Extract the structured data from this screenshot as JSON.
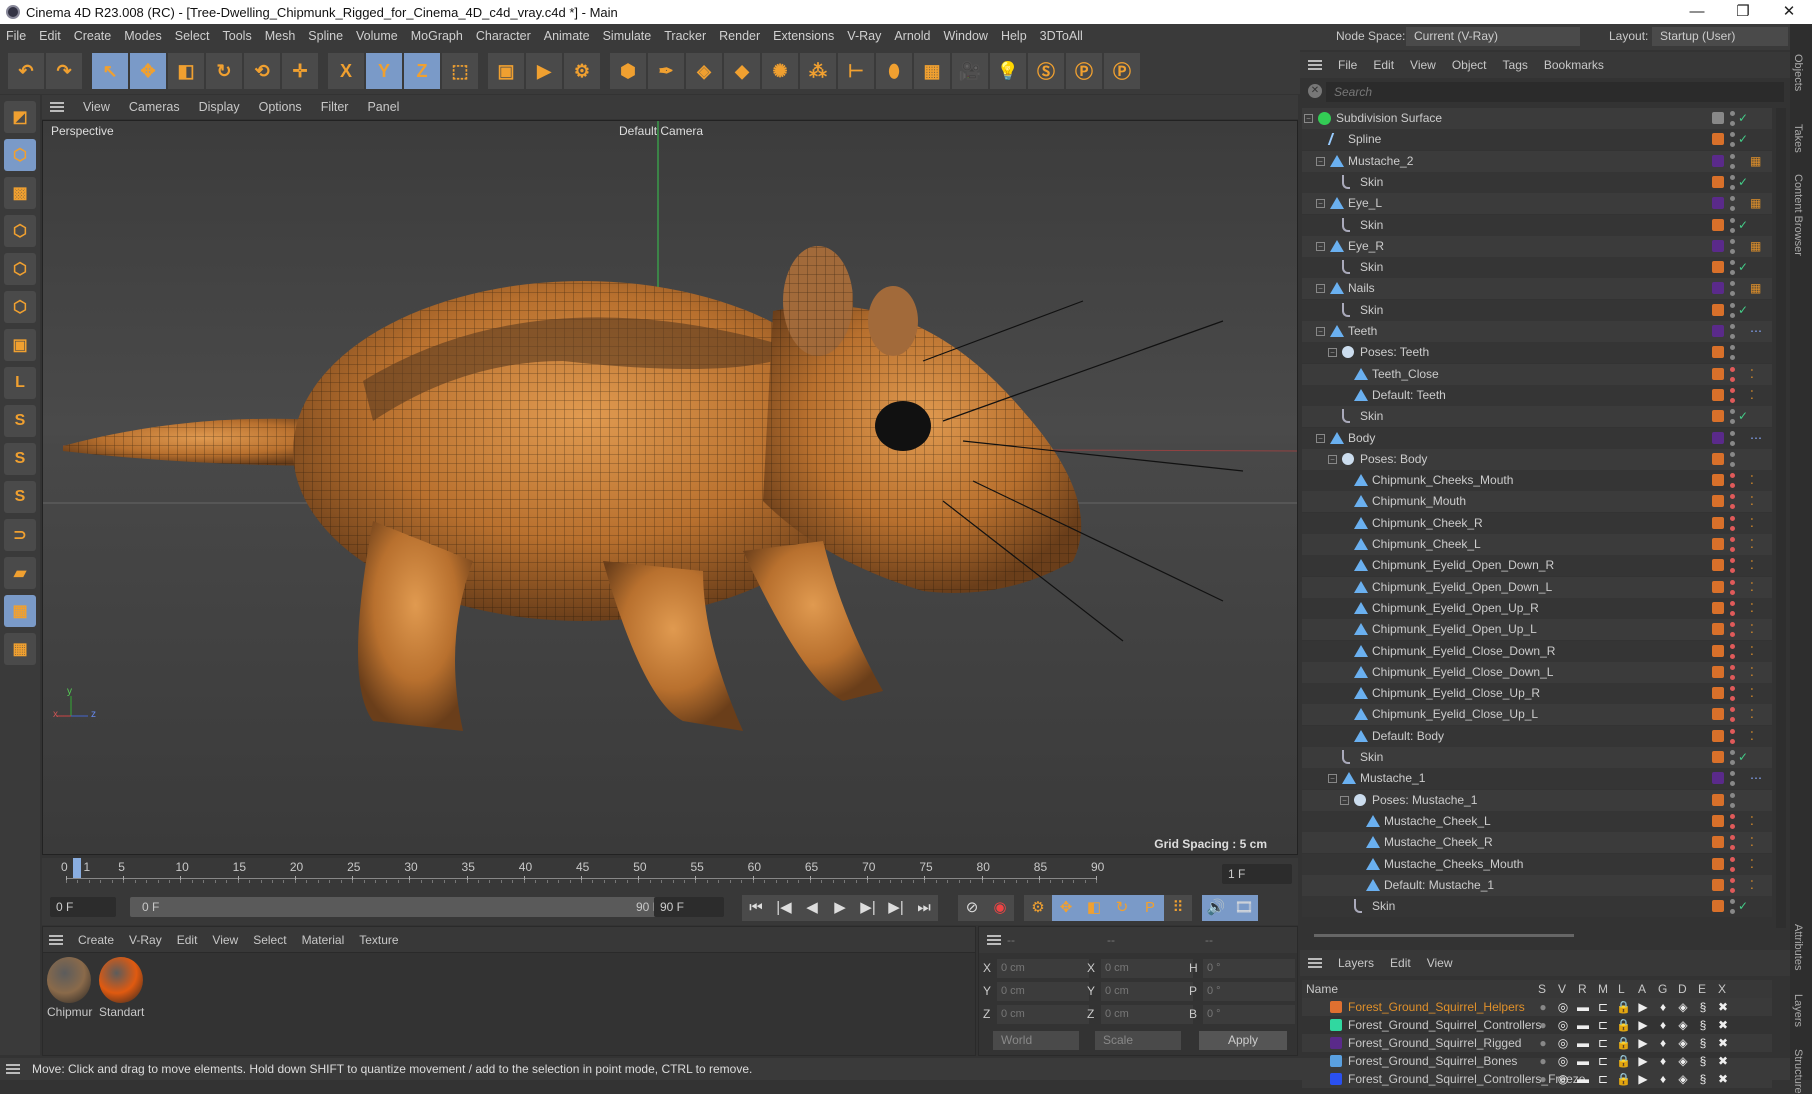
{
  "window": {
    "title": "Cinema 4D R23.008 (RC) - [Tree-Dwelling_Chipmunk_Rigged_for_Cinema_4D_c4d_vray.c4d *] - Main",
    "minimize": "—",
    "maximize": "❐",
    "close": "✕"
  },
  "menu": [
    "File",
    "Edit",
    "Create",
    "Modes",
    "Select",
    "Tools",
    "Mesh",
    "Spline",
    "Volume",
    "MoGraph",
    "Character",
    "Animate",
    "Simulate",
    "Tracker",
    "Render",
    "Extensions",
    "V-Ray",
    "Arnold",
    "Window",
    "Help",
    "3DToAll"
  ],
  "toolbar": [
    {
      "name": "undo",
      "g": "↶"
    },
    {
      "name": "redo",
      "g": "↷"
    },
    {
      "name": "select-tool",
      "g": "↖",
      "sel": true,
      "gap": true
    },
    {
      "name": "move-tool",
      "g": "✥",
      "sel": true
    },
    {
      "name": "scale-tool",
      "g": "◧"
    },
    {
      "name": "rotate-tool",
      "g": "↻"
    },
    {
      "name": "psr",
      "g": "⟲"
    },
    {
      "name": "transform",
      "g": "✛"
    },
    {
      "name": "x-axis",
      "g": "X",
      "gap": true
    },
    {
      "name": "y-axis",
      "g": "Y",
      "sel": true
    },
    {
      "name": "z-axis",
      "g": "Z",
      "sel": true
    },
    {
      "name": "coord-system",
      "g": "⬚"
    },
    {
      "name": "render-view",
      "g": "▣",
      "gap": true
    },
    {
      "name": "render-picture",
      "g": "▶"
    },
    {
      "name": "render-settings",
      "g": "⚙"
    },
    {
      "name": "cube",
      "g": "⬢",
      "gap": true
    },
    {
      "name": "pen",
      "g": "✒"
    },
    {
      "name": "subdivision",
      "g": "◈"
    },
    {
      "name": "extrude",
      "g": "◆"
    },
    {
      "name": "mograph-cloner",
      "g": "✺"
    },
    {
      "name": "cloner",
      "g": "⁂"
    },
    {
      "name": "deformer",
      "g": "⊢"
    },
    {
      "name": "field",
      "g": "⬮"
    },
    {
      "name": "floor",
      "g": "▦"
    },
    {
      "name": "camera",
      "g": "🎥"
    },
    {
      "name": "light",
      "g": "💡"
    },
    {
      "name": "vray",
      "g": "Ⓢ"
    },
    {
      "name": "python",
      "g": "Ⓟ"
    },
    {
      "name": "python-2",
      "g": "Ⓟ"
    }
  ],
  "left_tools": [
    {
      "name": "make-editable",
      "g": "◩"
    },
    {
      "name": "model-mode",
      "g": "⬡",
      "sel": true
    },
    {
      "name": "texture-mode",
      "g": "▩"
    },
    {
      "name": "points-mode",
      "g": "⬡"
    },
    {
      "name": "edges-mode",
      "g": "⬡"
    },
    {
      "name": "polygons-mode",
      "g": "⬡"
    },
    {
      "name": "uv-mode",
      "g": "▣"
    },
    {
      "name": "axis-mode",
      "g": "L"
    },
    {
      "name": "snap",
      "g": "S"
    },
    {
      "name": "snap-2",
      "g": "S"
    },
    {
      "name": "snap-3",
      "g": "S"
    },
    {
      "name": "magnet",
      "g": "⊃"
    },
    {
      "name": "workplane",
      "g": "▰"
    },
    {
      "name": "grid-lock",
      "g": "▦",
      "sel": true
    },
    {
      "name": "grid-3",
      "g": "▦"
    }
  ],
  "viewport": {
    "menu": [
      "View",
      "Cameras",
      "Display",
      "Options",
      "Filter",
      "Panel"
    ],
    "label": "Perspective",
    "camera": "Default Camera",
    "grid_spacing": "Grid Spacing : 5 cm",
    "axis": {
      "x": "x",
      "y": "y",
      "z": "z"
    }
  },
  "timeline": {
    "ticks": [
      0,
      5,
      10,
      15,
      20,
      25,
      30,
      35,
      40,
      45,
      50,
      55,
      60,
      65,
      70,
      75,
      80,
      85,
      90
    ],
    "current": "1",
    "current_frame_field": "1 F",
    "start_field": "0 F",
    "range_start": "0 F",
    "range_end": "90 F",
    "end_field": "90 F",
    "max_frame": 90,
    "current_value": 1
  },
  "playback": [
    {
      "name": "goto-start",
      "g": "⏮"
    },
    {
      "name": "prev-key",
      "g": "|◀"
    },
    {
      "name": "prev-frame",
      "g": "◀"
    },
    {
      "name": "play",
      "g": "▶"
    },
    {
      "name": "next-frame",
      "g": "▶|"
    },
    {
      "name": "next-key",
      "g": "▶|"
    },
    {
      "name": "goto-end",
      "g": "⏭"
    },
    {
      "name": "record-keys",
      "g": "⊘"
    },
    {
      "name": "auto-key",
      "g": "◉"
    },
    {
      "name": "keyframe-selection",
      "g": "⚙"
    },
    {
      "name": "key-position",
      "g": "✥"
    },
    {
      "name": "key-scale",
      "g": "◧"
    },
    {
      "name": "key-rotation",
      "g": "↻"
    },
    {
      "name": "key-param",
      "g": "P"
    },
    {
      "name": "key-pla",
      "g": "⠿"
    },
    {
      "name": "sound",
      "g": "🔊"
    },
    {
      "name": "film",
      "g": "🎞"
    }
  ],
  "materials": {
    "menu": [
      "Create",
      "V-Ray",
      "Edit",
      "View",
      "Select",
      "Material",
      "Texture"
    ],
    "items": [
      {
        "label": "Chipmur",
        "color": "#8a6a4a"
      },
      {
        "label": "Standart",
        "color": "#e05a10"
      }
    ]
  },
  "coords": {
    "header": [
      "--",
      "--",
      "--"
    ],
    "rows": [
      {
        "a": "X",
        "av": "0 cm",
        "b": "X",
        "bv": "0 cm",
        "c": "H",
        "cv": "0 °"
      },
      {
        "a": "Y",
        "av": "0 cm",
        "b": "Y",
        "bv": "0 cm",
        "c": "P",
        "cv": "0 °"
      },
      {
        "a": "Z",
        "av": "0 cm",
        "b": "Z",
        "bv": "0 cm",
        "c": "B",
        "cv": "0 °"
      }
    ],
    "world": "World",
    "scale": "Scale",
    "apply": "Apply"
  },
  "status": "Move: Click and drag to move elements. Hold down SHIFT to quantize movement / add to the selection in point mode, CTRL to remove.",
  "right": {
    "node_space_label": "Node Space:",
    "node_space_value": "Current (V-Ray)",
    "layout_label": "Layout:",
    "layout_value": "Startup (User)",
    "menu": [
      "File",
      "Edit",
      "View",
      "Object",
      "Tags",
      "Bookmarks"
    ],
    "search_placeholder": "Search"
  },
  "colors": {
    "orange": "#d8702a",
    "purple": "#5a2a8a",
    "gray": "#888888",
    "red": "#e05a5a",
    "check": "#44cc88"
  },
  "tree": [
    {
      "l": "Subdivision Surface",
      "d": 0,
      "i": "green",
      "e": 1,
      "c": "gray",
      "dt": "gray",
      "k": 1,
      "x": ""
    },
    {
      "l": "Spline",
      "d": 1,
      "i": "spline",
      "c": "orange",
      "dt": "gray",
      "k": 1,
      "x": ""
    },
    {
      "l": "Mustache_2",
      "d": 1,
      "i": "poly",
      "e": 1,
      "c": "purple",
      "dt": "gray",
      "x": "checker"
    },
    {
      "l": "Skin",
      "d": 2,
      "i": "skin",
      "c": "orange",
      "dt": "gray",
      "k": 1,
      "x": ""
    },
    {
      "l": "Eye_L",
      "d": 1,
      "i": "poly",
      "e": 1,
      "c": "purple",
      "dt": "gray",
      "x": "checker"
    },
    {
      "l": "Skin",
      "d": 2,
      "i": "skin",
      "c": "orange",
      "dt": "gray",
      "k": 1,
      "x": ""
    },
    {
      "l": "Eye_R",
      "d": 1,
      "i": "poly",
      "e": 1,
      "c": "purple",
      "dt": "gray",
      "x": "checker"
    },
    {
      "l": "Skin",
      "d": 2,
      "i": "skin",
      "c": "orange",
      "dt": "gray",
      "k": 1,
      "x": ""
    },
    {
      "l": "Nails",
      "d": 1,
      "i": "poly",
      "e": 1,
      "c": "purple",
      "dt": "gray",
      "x": "checker"
    },
    {
      "l": "Skin",
      "d": 2,
      "i": "skin",
      "c": "orange",
      "dt": "gray",
      "k": 1,
      "x": ""
    },
    {
      "l": "Teeth",
      "d": 1,
      "i": "poly",
      "e": 1,
      "c": "purple",
      "dt": "gray",
      "x": "weights"
    },
    {
      "l": "Poses: Teeth",
      "d": 2,
      "i": "pose",
      "e": 1,
      "c": "orange",
      "dt": "gray",
      "x": ""
    },
    {
      "l": "Teeth_Close",
      "d": 3,
      "i": "poly",
      "c": "orange",
      "dt": "red",
      "x": "morph"
    },
    {
      "l": "Default: Teeth",
      "d": 3,
      "i": "poly",
      "c": "orange",
      "dt": "red",
      "x": "morph"
    },
    {
      "l": "Skin",
      "d": 2,
      "i": "skin",
      "c": "orange",
      "dt": "gray",
      "k": 1,
      "x": ""
    },
    {
      "l": "Body",
      "d": 1,
      "i": "poly",
      "e": 1,
      "c": "purple",
      "dt": "gray",
      "x": "weights"
    },
    {
      "l": "Poses: Body",
      "d": 2,
      "i": "pose",
      "e": 1,
      "c": "orange",
      "dt": "gray",
      "x": ""
    },
    {
      "l": "Chipmunk_Cheeks_Mouth",
      "d": 3,
      "i": "poly",
      "c": "orange",
      "dt": "red",
      "x": "morph"
    },
    {
      "l": "Chipmunk_Mouth",
      "d": 3,
      "i": "poly",
      "c": "orange",
      "dt": "red",
      "x": "morph"
    },
    {
      "l": "Chipmunk_Cheek_R",
      "d": 3,
      "i": "poly",
      "c": "orange",
      "dt": "red",
      "x": "morph"
    },
    {
      "l": "Chipmunk_Cheek_L",
      "d": 3,
      "i": "poly",
      "c": "orange",
      "dt": "red",
      "x": "morph"
    },
    {
      "l": "Chipmunk_Eyelid_Open_Down_R",
      "d": 3,
      "i": "poly",
      "c": "orange",
      "dt": "red",
      "x": "morph"
    },
    {
      "l": "Chipmunk_Eyelid_Open_Down_L",
      "d": 3,
      "i": "poly",
      "c": "orange",
      "dt": "red",
      "x": "morph"
    },
    {
      "l": "Chipmunk_Eyelid_Open_Up_R",
      "d": 3,
      "i": "poly",
      "c": "orange",
      "dt": "red",
      "x": "morph"
    },
    {
      "l": "Chipmunk_Eyelid_Open_Up_L",
      "d": 3,
      "i": "poly",
      "c": "orange",
      "dt": "red",
      "x": "morph"
    },
    {
      "l": "Chipmunk_Eyelid_Close_Down_R",
      "d": 3,
      "i": "poly",
      "c": "orange",
      "dt": "red",
      "x": "morph"
    },
    {
      "l": "Chipmunk_Eyelid_Close_Down_L",
      "d": 3,
      "i": "poly",
      "c": "orange",
      "dt": "red",
      "x": "morph"
    },
    {
      "l": "Chipmunk_Eyelid_Close_Up_R",
      "d": 3,
      "i": "poly",
      "c": "orange",
      "dt": "red",
      "x": "morph"
    },
    {
      "l": "Chipmunk_Eyelid_Close_Up_L",
      "d": 3,
      "i": "poly",
      "c": "orange",
      "dt": "red",
      "x": "morph"
    },
    {
      "l": "Default: Body",
      "d": 3,
      "i": "poly",
      "c": "orange",
      "dt": "red",
      "x": "morph"
    },
    {
      "l": "Skin",
      "d": 2,
      "i": "skin",
      "c": "orange",
      "dt": "gray",
      "k": 1,
      "x": ""
    },
    {
      "l": "Mustache_1",
      "d": 2,
      "i": "poly",
      "e": 1,
      "c": "purple",
      "dt": "gray",
      "x": "weights"
    },
    {
      "l": "Poses: Mustache_1",
      "d": 3,
      "i": "pose",
      "e": 1,
      "c": "orange",
      "dt": "gray",
      "x": ""
    },
    {
      "l": "Mustache_Cheek_L",
      "d": 4,
      "i": "poly",
      "c": "orange",
      "dt": "red",
      "x": "morph"
    },
    {
      "l": "Mustache_Cheek_R",
      "d": 4,
      "i": "poly",
      "c": "orange",
      "dt": "red",
      "x": "morph"
    },
    {
      "l": "Mustache_Cheeks_Mouth",
      "d": 4,
      "i": "poly",
      "c": "orange",
      "dt": "red",
      "x": "morph"
    },
    {
      "l": "Default: Mustache_1",
      "d": 4,
      "i": "poly",
      "c": "orange",
      "dt": "red",
      "x": "morph"
    },
    {
      "l": "Skin",
      "d": 3,
      "i": "skin",
      "c": "orange",
      "dt": "gray",
      "k": 1,
      "x": ""
    }
  ],
  "layers": {
    "menu": [
      "Layers",
      "Edit",
      "View"
    ],
    "columns": [
      "Name",
      "S",
      "V",
      "R",
      "M",
      "L",
      "A",
      "G",
      "D",
      "E",
      "X"
    ],
    "items": [
      {
        "name": "Forest_Ground_Squirrel_Helpers",
        "color": "#e07030",
        "highlight": true
      },
      {
        "name": "Forest_Ground_Squirrel_Controllers",
        "color": "#30d8a0"
      },
      {
        "name": "Forest_Ground_Squirrel_Rigged",
        "color": "#5a2a8a"
      },
      {
        "name": "Forest_Ground_Squirrel_Bones",
        "color": "#5aa0e0"
      },
      {
        "name": "Forest_Ground_Squirrel_Controllers_Freeze",
        "color": "#2a50f0"
      }
    ]
  },
  "side_tabs": [
    "Objects",
    "Takes",
    "Content Browser",
    "Attributes",
    "Layers",
    "Structure"
  ]
}
